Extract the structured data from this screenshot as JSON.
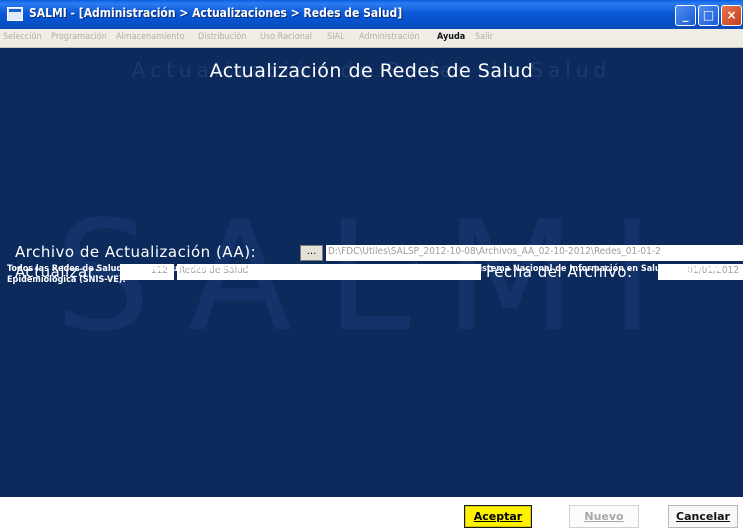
{
  "window": {
    "title": "SALMI - [Administración > Actualizaciones > Redes de Salud]",
    "controls": {
      "minimize": "_",
      "maximize": "□",
      "close": "×"
    }
  },
  "menu": {
    "items": [
      {
        "label": "Selección",
        "enabled": false
      },
      {
        "label": "Programación",
        "enabled": false
      },
      {
        "label": "Almacenamiento",
        "enabled": false
      },
      {
        "label": "Distribución",
        "enabled": false
      },
      {
        "label": "Uso Racional",
        "enabled": false
      },
      {
        "label": "SIAL",
        "enabled": false
      },
      {
        "label": "Administración",
        "enabled": false
      },
      {
        "label": "Ayuda",
        "enabled": true
      },
      {
        "label": "Salir",
        "enabled": false
      }
    ]
  },
  "page": {
    "title": "Actualización de Redes de Salud",
    "title_shadow": "Actualización de Redes de Salud",
    "watermark": "SALMI"
  },
  "form": {
    "archivo_label": "Archivo de Actualización (AA):",
    "browse_label": "...",
    "archivo_path": "D:\\FDC\\Utiles\\SALSP_2012-10-08\\Archivos_AA_02-10-2012\\Redes_01-01-2",
    "actualizar_label": "Actualizar:",
    "count": "112",
    "item_name": "Redes de Salud",
    "fecha_label": "Fecha del Archivo:",
    "fecha_value": "01/01/2012",
    "info": "Todos las Redes de Salud que se actualicen en esta ventana corresponden a la información oficial del Sistema Nacional de Información en Salud y Vigilancia Epidemiológica (SNIS-VE)."
  },
  "buttons": {
    "accept": "Aceptar",
    "new": "Nuevo",
    "cancel": "Cancelar"
  },
  "colors": {
    "background": "#0c2a5c",
    "titlebar": "#0b58d8",
    "accept_highlight": "#fff200"
  }
}
